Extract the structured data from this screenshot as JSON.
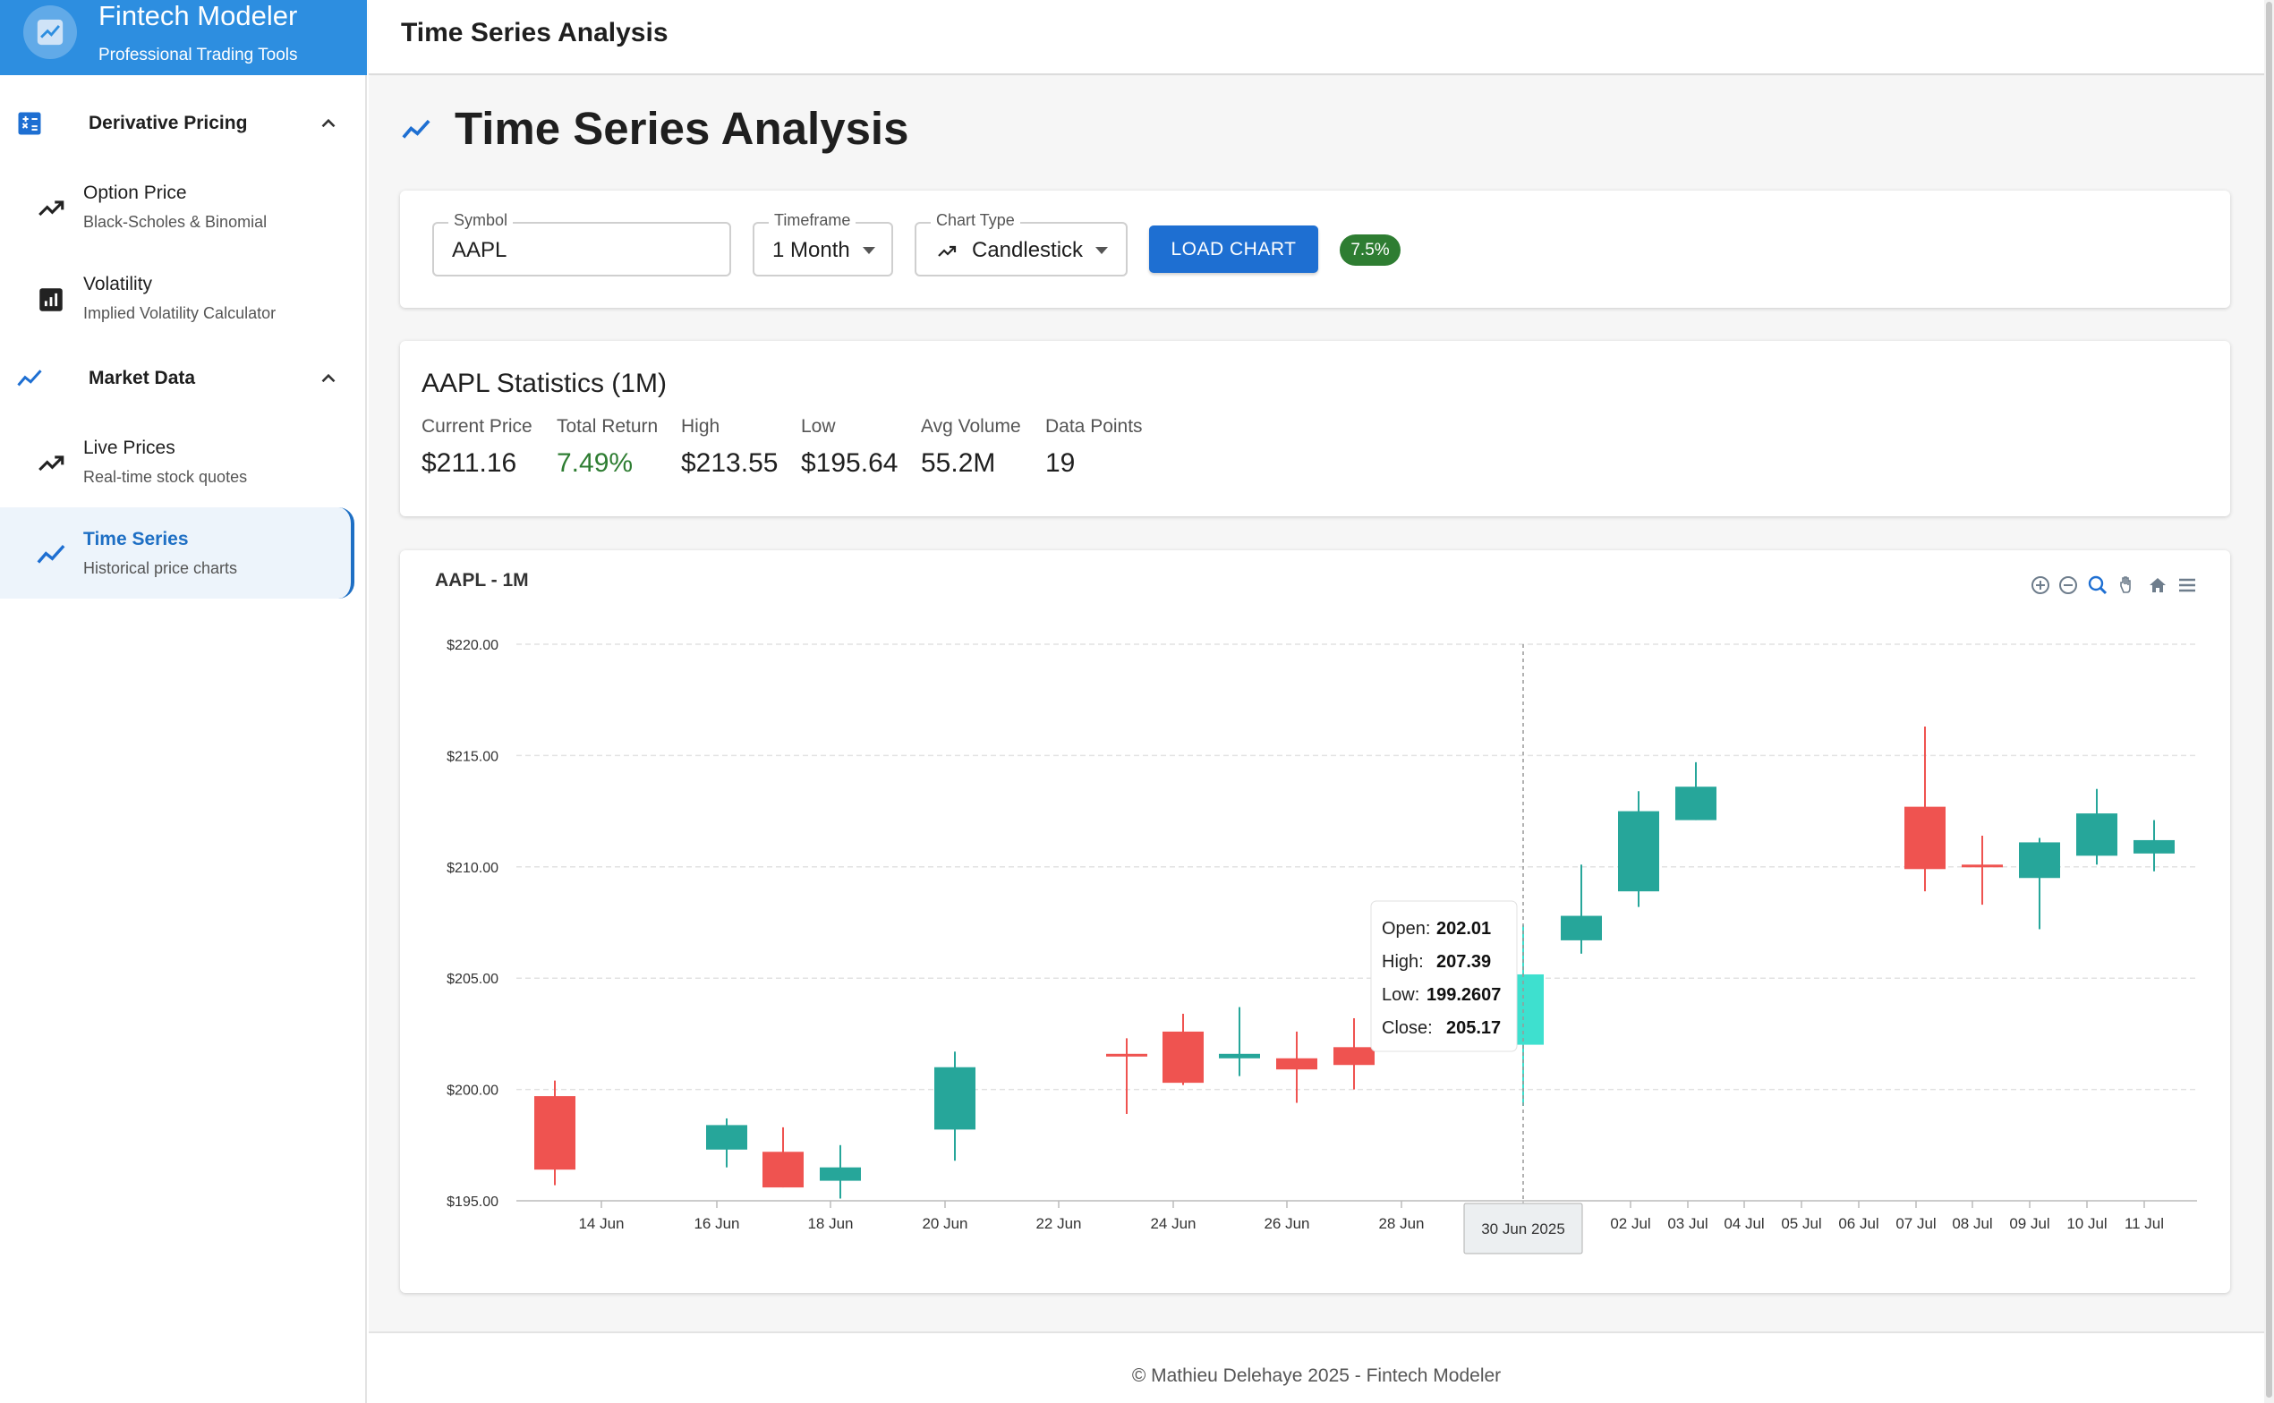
{
  "brand": {
    "title": "Fintech Modeler",
    "subtitle": "Professional Trading Tools"
  },
  "sidebar": {
    "sections": [
      {
        "label": "Derivative Pricing",
        "icon": "calculator-icon",
        "items": [
          {
            "title": "Option Price",
            "subtitle": "Black-Scholes & Binomial",
            "icon": "trending-up-icon"
          },
          {
            "title": "Volatility",
            "subtitle": "Implied Volatility Calculator",
            "icon": "bar-chart-icon"
          }
        ]
      },
      {
        "label": "Market Data",
        "icon": "show-chart-icon",
        "items": [
          {
            "title": "Live Prices",
            "subtitle": "Real-time stock quotes",
            "icon": "trending-up-icon"
          },
          {
            "title": "Time Series",
            "subtitle": "Historical price charts",
            "icon": "show-chart-icon",
            "active": true
          }
        ]
      }
    ]
  },
  "topbar": {
    "title": "Time Series Analysis"
  },
  "page": {
    "heading": "Time Series Analysis"
  },
  "controls": {
    "symbol": {
      "label": "Symbol",
      "value": "AAPL"
    },
    "timeframe": {
      "label": "Timeframe",
      "value": "1 Month"
    },
    "chart_type": {
      "label": "Chart Type",
      "value": "Candlestick"
    },
    "load_button": "LOAD CHART",
    "change_chip": "7.5%"
  },
  "stats": {
    "title": "AAPL Statistics (1M)",
    "items": [
      {
        "label": "Current Price",
        "value": "$211.16"
      },
      {
        "label": "Total Return",
        "value": "7.49%"
      },
      {
        "label": "High",
        "value": "$213.55"
      },
      {
        "label": "Low",
        "value": "$195.64"
      },
      {
        "label": "Avg Volume",
        "value": "55.2M"
      },
      {
        "label": "Data Points",
        "value": "19"
      }
    ]
  },
  "colors": {
    "accent": "#1e6fd2",
    "up": "#26a69a",
    "down": "#ef5350",
    "positive_text": "#2e7d32",
    "hover_up": "#3ee0cf"
  },
  "chart_data": {
    "type": "candlestick",
    "title": "AAPL - 1M",
    "ylim": [
      195,
      220
    ],
    "y_ticks": [
      "$195.00",
      "$200.00",
      "$205.00",
      "$210.00",
      "$215.00",
      "$220.00"
    ],
    "x_ticks": [
      "14 Jun",
      "16 Jun",
      "18 Jun",
      "20 Jun",
      "22 Jun",
      "24 Jun",
      "26 Jun",
      "28 Jun",
      "30 Jun 2025",
      "02 Jul",
      "03 Jul",
      "04 Jul",
      "05 Jul",
      "06 Jul",
      "07 Jul",
      "08 Jul",
      "09 Jul",
      "10 Jul",
      "11 Jul"
    ],
    "toolbar_icons": [
      "zoom-in-icon",
      "zoom-out-icon",
      "zoom-select-icon",
      "pan-hand-icon",
      "reset-home-icon",
      "menu-icon"
    ],
    "candles": [
      {
        "date": "2025-06-13",
        "open": 199.7,
        "high": 200.4,
        "low": 195.7,
        "close": 196.4
      },
      {
        "date": "2025-06-16",
        "open": 197.3,
        "high": 198.7,
        "low": 196.5,
        "close": 198.4
      },
      {
        "date": "2025-06-17",
        "open": 197.2,
        "high": 198.3,
        "low": 195.6,
        "close": 195.6
      },
      {
        "date": "2025-06-18",
        "open": 195.9,
        "high": 197.5,
        "low": 195.1,
        "close": 196.5
      },
      {
        "date": "2025-06-20",
        "open": 198.2,
        "high": 201.7,
        "low": 196.8,
        "close": 201.0
      },
      {
        "date": "2025-06-23",
        "open": 201.6,
        "high": 202.3,
        "low": 198.9,
        "close": 201.5
      },
      {
        "date": "2025-06-24",
        "open": 202.6,
        "high": 203.4,
        "low": 200.2,
        "close": 200.3
      },
      {
        "date": "2025-06-25",
        "open": 201.4,
        "high": 203.7,
        "low": 200.6,
        "close": 201.6
      },
      {
        "date": "2025-06-26",
        "open": 201.4,
        "high": 202.6,
        "low": 199.4,
        "close": 200.9
      },
      {
        "date": "2025-06-27",
        "open": 201.9,
        "high": 203.2,
        "low": 200.0,
        "close": 201.1
      },
      {
        "date": "2025-06-30",
        "open": 202.01,
        "high": 207.39,
        "low": 199.2607,
        "close": 205.17,
        "highlighted": true
      },
      {
        "date": "2025-07-01",
        "open": 206.7,
        "high": 210.1,
        "low": 206.1,
        "close": 207.8
      },
      {
        "date": "2025-07-02",
        "open": 208.9,
        "high": 213.4,
        "low": 208.2,
        "close": 212.5
      },
      {
        "date": "2025-07-03",
        "open": 212.1,
        "high": 214.7,
        "low": 212.1,
        "close": 213.6
      },
      {
        "date": "2025-07-07",
        "open": 212.7,
        "high": 216.3,
        "low": 208.9,
        "close": 209.9
      },
      {
        "date": "2025-07-08",
        "open": 210.1,
        "high": 211.4,
        "low": 208.3,
        "close": 210.0
      },
      {
        "date": "2025-07-09",
        "open": 209.5,
        "high": 211.3,
        "low": 207.2,
        "close": 211.1
      },
      {
        "date": "2025-07-10",
        "open": 210.5,
        "high": 213.5,
        "low": 210.1,
        "close": 212.4
      },
      {
        "date": "2025-07-11",
        "open": 210.6,
        "high": 212.1,
        "low": 209.8,
        "close": 211.2
      }
    ],
    "crosshair_label": "30 Jun 2025",
    "tooltip": [
      {
        "label": "Open:",
        "value": "202.01"
      },
      {
        "label": "High:",
        "value": "207.39"
      },
      {
        "label": "Low:",
        "value": "199.2607"
      },
      {
        "label": "Close:",
        "value": "205.17"
      }
    ]
  },
  "footer": "© Mathieu Delehaye 2025 - Fintech Modeler"
}
